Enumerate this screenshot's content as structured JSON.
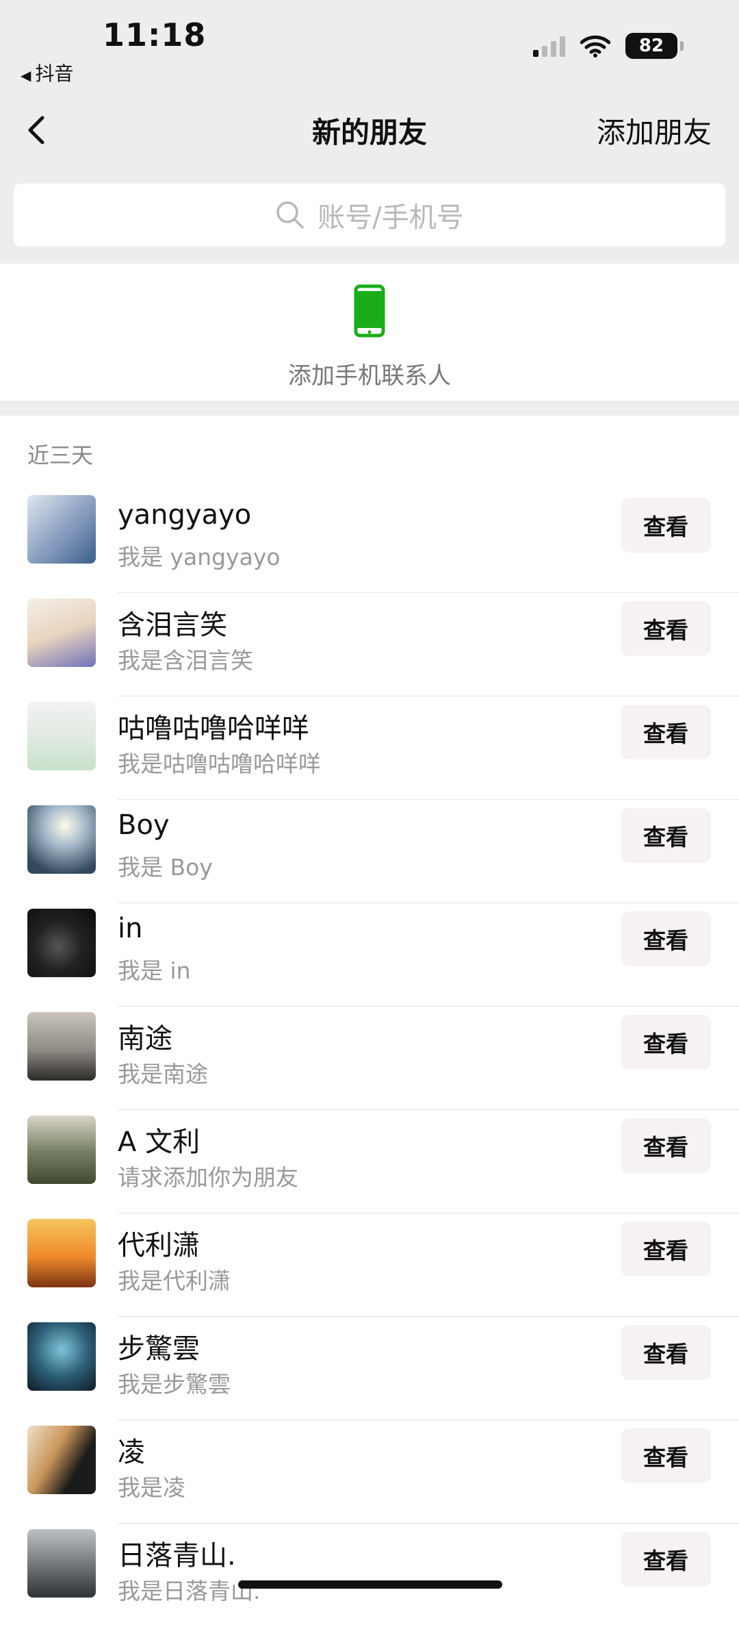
{
  "status_bar": {
    "time": "11:18",
    "back_app": "抖音",
    "battery": "82"
  },
  "nav": {
    "title": "新的朋友",
    "add_button": "添加朋友"
  },
  "search": {
    "placeholder": "账号/手机号"
  },
  "contacts_entry": {
    "label": "添加手机联系人",
    "icon": "phone-icon",
    "icon_color": "#1aad19"
  },
  "section": {
    "title": "近三天"
  },
  "friends": [
    {
      "name": "yangyayo",
      "message": "我是 yangyayo",
      "button": "查看"
    },
    {
      "name": "含泪言笑",
      "message": "我是含泪言笑",
      "button": "查看"
    },
    {
      "name": "咕噜咕噜哈咩咩",
      "message": "我是咕噜咕噜哈咩咩",
      "button": "查看"
    },
    {
      "name": "Boy",
      "message": "我是 Boy",
      "button": "查看"
    },
    {
      "name": "in",
      "message": "我是 in",
      "button": "查看"
    },
    {
      "name": "南途",
      "message": "我是南途",
      "button": "查看"
    },
    {
      "name": "A 文利",
      "message": "请求添加你为朋友",
      "button": "查看"
    },
    {
      "name": "代利潇",
      "message": "我是代利潇",
      "button": "查看"
    },
    {
      "name": "步驚雲",
      "message": "我是步驚雲",
      "button": "查看"
    },
    {
      "name": "凌",
      "message": "我是凌",
      "button": "查看"
    },
    {
      "name": "日落青山.",
      "message": "我是日落青山.",
      "button": "查看"
    }
  ]
}
